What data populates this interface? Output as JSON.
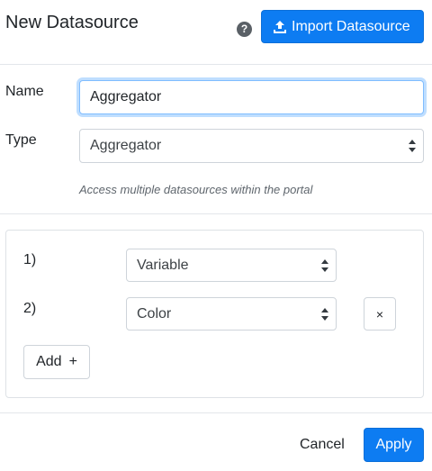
{
  "header": {
    "title": "New Datasource",
    "help_icon": "question-circle-icon",
    "import_button": "Import Datasource",
    "import_icon": "upload-icon"
  },
  "form": {
    "name_label": "Name",
    "name_value": "Aggregator",
    "type_label": "Type",
    "type_value": "Aggregator",
    "type_help": "Access multiple datasources within the portal"
  },
  "aggregator": {
    "rows": [
      {
        "index": "1)",
        "value": "Variable"
      },
      {
        "index": "2)",
        "value": "Color",
        "remove_label": "×"
      }
    ],
    "add_label": "Add",
    "add_icon": "+"
  },
  "footer": {
    "cancel_label": "Cancel",
    "apply_label": "Apply"
  },
  "colors": {
    "primary": "#0d7cf2",
    "focus_ring": "#80bdff"
  }
}
